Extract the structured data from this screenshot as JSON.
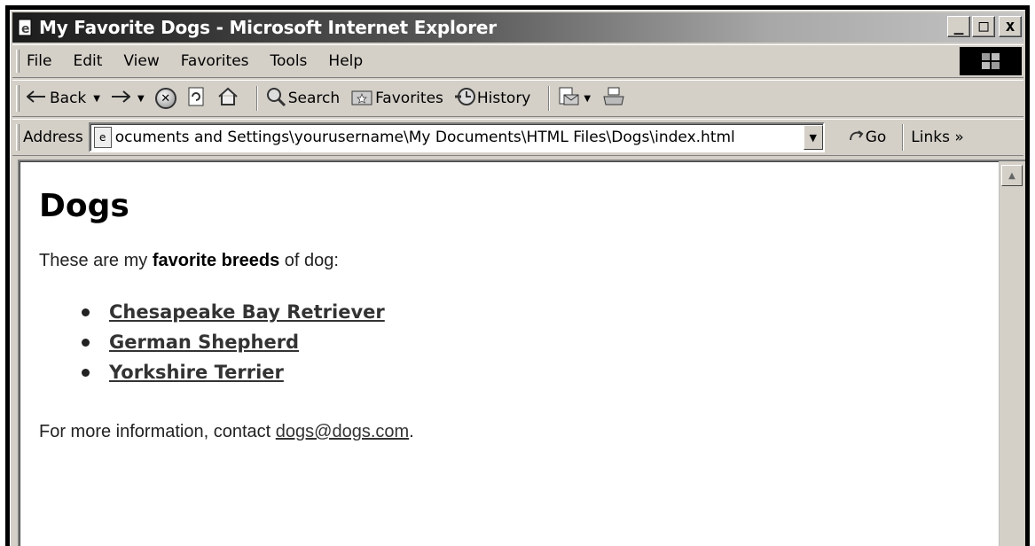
{
  "window": {
    "title": "My Favorite Dogs - Microsoft Internet Explorer",
    "buttons": {
      "minimize": "_",
      "maximize": "□",
      "close": "x"
    }
  },
  "menubar": {
    "items": [
      "File",
      "Edit",
      "View",
      "Favorites",
      "Tools",
      "Help"
    ]
  },
  "toolbar": {
    "back": "Back",
    "search": "Search",
    "favorites": "Favorites",
    "history": "History"
  },
  "addressbar": {
    "label": "Address",
    "value": "ocuments and Settings\\yourusername\\My Documents\\HTML Files\\Dogs\\index.html",
    "go": "Go",
    "links": "Links »"
  },
  "page": {
    "heading": "Dogs",
    "intro_before": "These are my ",
    "intro_bold": "favorite breeds",
    "intro_after": " of dog:",
    "breeds": [
      "Chesapeake Bay Retriever",
      "German Shepherd",
      "Yorkshire Terrier"
    ],
    "contact_prefix": "For more information, contact ",
    "contact_email": "dogs@dogs.com",
    "contact_suffix": "."
  },
  "icons": {
    "title": "ie-page-icon",
    "back": "back-arrow-icon",
    "forward": "forward-arrow-icon",
    "stop": "stop-icon",
    "refresh": "refresh-icon",
    "home": "home-icon",
    "search": "search-icon",
    "favorites": "favorites-icon",
    "history": "history-icon",
    "mail": "mail-icon",
    "print": "print-icon",
    "go": "go-arrow-icon"
  }
}
